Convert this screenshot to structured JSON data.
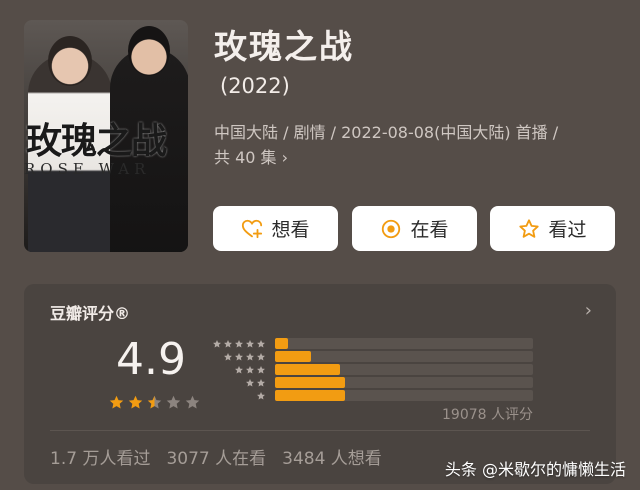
{
  "poster": {
    "title_cn": "玫瑰之战",
    "title_en": "ROSE WAR"
  },
  "movie": {
    "title": "玫瑰之战",
    "year": "(2022)",
    "meta_line1": "中国大陆 / 剧情 / 2022-08-08(中国大陆) 首播 /",
    "meta_line2": "共 40 集",
    "meta_chevron": "›"
  },
  "actions": {
    "want": "想看",
    "watching": "在看",
    "watched": "看过"
  },
  "rating": {
    "title": "豆瓣评分®",
    "score": "4.9",
    "stars_value": 2.5,
    "count": "19078 人评分",
    "distribution": [
      {
        "stars": 5,
        "fraction": 0.05
      },
      {
        "stars": 4,
        "fraction": 0.14
      },
      {
        "stars": 3,
        "fraction": 0.25
      },
      {
        "stars": 2,
        "fraction": 0.27
      },
      {
        "stars": 1,
        "fraction": 0.27
      }
    ],
    "chevron": "›"
  },
  "stats": {
    "watched": "1.7 万人看过",
    "watching": "3077 人在看",
    "want": "3484 人想看"
  },
  "watermark": "头条 @米歇尔的慵懒生活",
  "colors": {
    "accent": "#f29c12",
    "star_on": "#f29c12",
    "star_off": "#8c847f",
    "background": "#554d48"
  }
}
